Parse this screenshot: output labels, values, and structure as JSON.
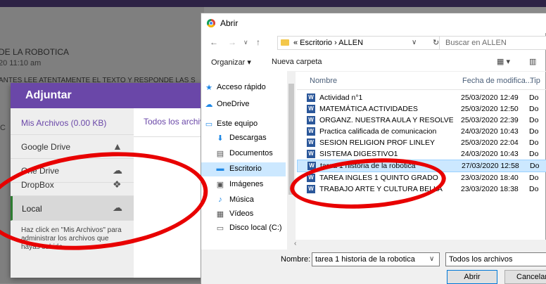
{
  "background": {
    "title": "DE LA ROBOTICA",
    "date": "20 11:10 am",
    "instructions": "ANTES LEE ATENTAMENTE EL TEXTO Y RESPONDE LAS S",
    "partial": "C"
  },
  "modal": {
    "title": "Adjuntar",
    "tab_all": "Todos los archivos",
    "sources": [
      {
        "label": "Mis Archivos (0.00 KB)",
        "icon": ""
      },
      {
        "label": "Google Drive",
        "icon": "▲"
      },
      {
        "label": "One Drive",
        "icon": "☁"
      },
      {
        "label": "DropBox",
        "icon": "❖"
      },
      {
        "label": "Local",
        "icon": "☁"
      }
    ],
    "help": "Haz click en \"Mis Archivos\" para administrar los archivos que hayas subido."
  },
  "dialog": {
    "title": "Abrir",
    "address": "«  Escritorio  ›  ALLEN",
    "search_placeholder": "Buscar en ALLEN",
    "organizar": "Organizar ▾",
    "nueva_carpeta": "Nueva carpeta",
    "nav": [
      {
        "label": "Acceso rápido",
        "icon": "★",
        "color": "#1e88e5"
      },
      {
        "label": "OneDrive",
        "icon": "☁",
        "color": "#1e88e5"
      },
      {
        "label": "Este equipo",
        "icon": "▭",
        "color": "#1e88e5"
      },
      {
        "label": "Descargas",
        "icon": "⬇",
        "color": "#1e88e5"
      },
      {
        "label": "Documentos",
        "icon": "▤",
        "color": "#555"
      },
      {
        "label": "Escritorio",
        "icon": "▬",
        "color": "#1e88e5"
      },
      {
        "label": "Imágenes",
        "icon": "▣",
        "color": "#555"
      },
      {
        "label": "Música",
        "icon": "♪",
        "color": "#1e88e5"
      },
      {
        "label": "Vídeos",
        "icon": "▦",
        "color": "#555"
      },
      {
        "label": "Disco local (C:)",
        "icon": "▭",
        "color": "#555"
      }
    ],
    "columns": {
      "name": "Nombre",
      "date": "Fecha de modifica...",
      "type": "Tip"
    },
    "files": [
      {
        "name": "Actividad n°1",
        "date": "25/03/2020 12:49",
        "type": "Do"
      },
      {
        "name": "MATEMÁTICA   ACTIVIDADES",
        "date": "25/03/2020 12:50",
        "type": "Do"
      },
      {
        "name": "ORGANZ. NUESTRA AULA Y RESOLVER C...",
        "date": "25/03/2020 22:39",
        "type": "Do"
      },
      {
        "name": "Practica calificada de comunicacion",
        "date": "24/03/2020 10:43",
        "type": "Do"
      },
      {
        "name": "SESION RELIGION PROF LINLEY",
        "date": "25/03/2020 22:04",
        "type": "Do"
      },
      {
        "name": "SISTEMA DIGESTIVO1",
        "date": "24/03/2020 10:43",
        "type": "Do"
      },
      {
        "name": "tarea 1 historia de la robotica",
        "date": "27/03/2020 12:58",
        "type": "Do"
      },
      {
        "name": "TAREA INGLES 1 QUINTO GRADO",
        "date": "23/03/2020 18:40",
        "type": "Do"
      },
      {
        "name": "TRABAJO ARTE Y CULTURA BELLA",
        "date": "23/03/2020 18:38",
        "type": "Do"
      }
    ],
    "filename_label": "Nombre:",
    "filename_value": "tarea 1 historia de la robotica",
    "filter_value": "Todos los archivos",
    "open_button": "Abrir",
    "cancel_button": "Cancelar"
  },
  "colors": {
    "accent": "#6a47a8",
    "annotation": "#e80000"
  }
}
